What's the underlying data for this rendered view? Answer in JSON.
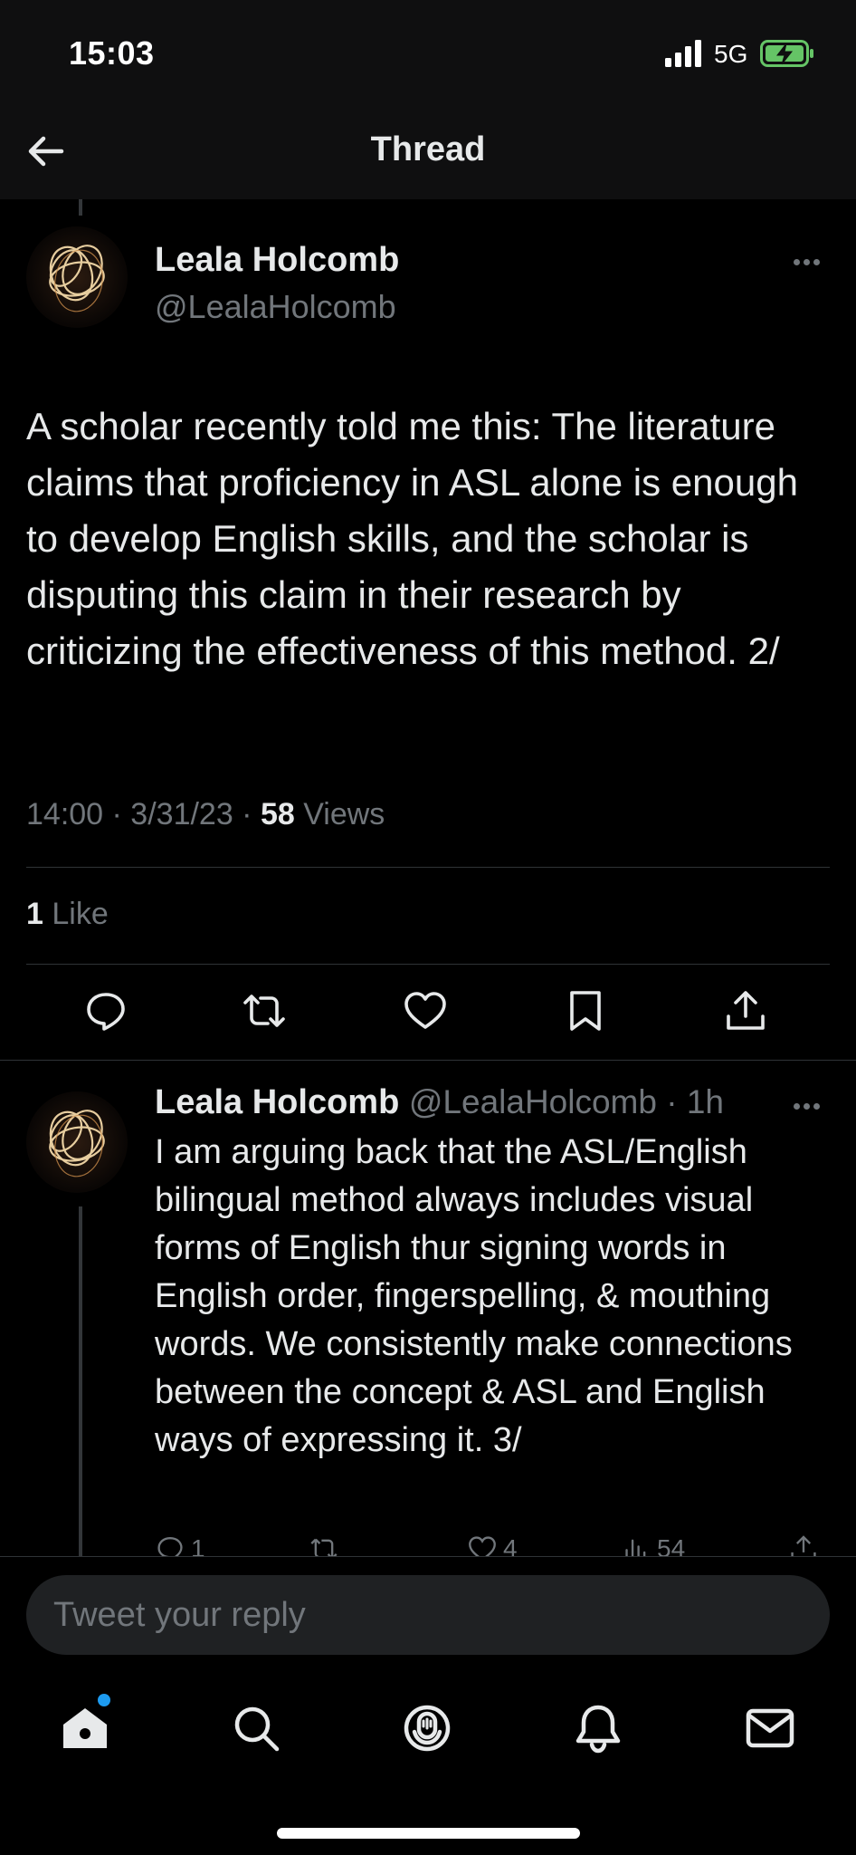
{
  "status_bar": {
    "time": "15:03",
    "network": "5G"
  },
  "header": {
    "title": "Thread"
  },
  "main_tweet": {
    "author_name": "Leala Holcomb",
    "author_handle": "@LealaHolcomb",
    "text": "A scholar recently told me this: The literature claims that proficiency in ASL alone is enough to develop English skills, and the scholar is disputing this claim in their research by criticizing the effectiveness of this method.  2/",
    "time_date": "14:00 · 3/31/23 · ",
    "views_count": "58",
    "views_label": " Views",
    "likes_count": "1",
    "likes_label": " Like"
  },
  "reply_tweet": {
    "author_name": "Leala Holcomb",
    "author_handle": "@LealaHolcomb",
    "age": " · 1h",
    "text": "I am arguing back that the ASL/English bilingual method always includes visual forms of English thur signing words in English order, fingerspelling, & mouthing words. We consistently make connections between the concept & ASL and English ways of expressing it. 3/",
    "reply_count": "1",
    "like_count": "4",
    "view_count": "54"
  },
  "composer": {
    "placeholder": "Tweet your reply"
  },
  "colors": {
    "background": "#000000",
    "accent": "#1d9bf0",
    "muted": "#71767b",
    "text": "#e7e9ea",
    "battery": "#65c466"
  }
}
